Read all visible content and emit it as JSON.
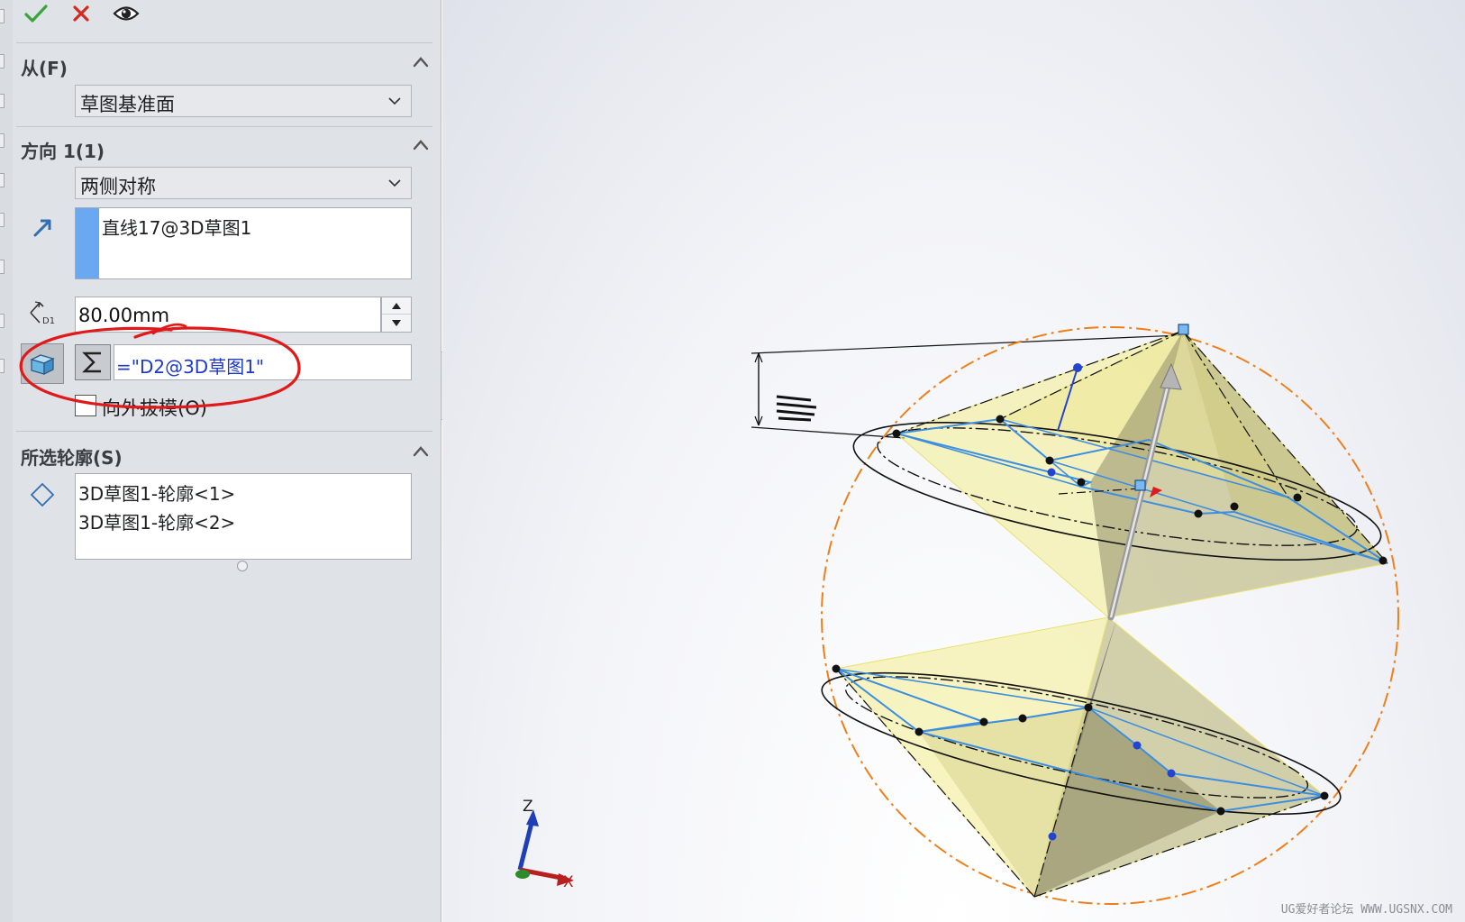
{
  "toolbar": {
    "ok_icon": "checkmark-icon",
    "cancel_icon": "x-icon",
    "preview_icon": "eye-icon"
  },
  "section_from": {
    "title": "从(F)",
    "start_condition": "草图基准面"
  },
  "section_direction1": {
    "title": "方向 1(1)",
    "end_condition": "两侧对称",
    "direction_reference": "直线17@3D草图1",
    "depth_value": "80.00mm",
    "depth_label": "D1",
    "equation_value": "=\"D2@3D草图1\"",
    "draft_outward_label": "向外拔模(O)",
    "draft_outward_checked": false
  },
  "section_contours": {
    "title": "所选轮廓(S)",
    "items": [
      "3D草图1-轮廓<1>",
      "3D草图1-轮廓<2>"
    ]
  },
  "viewport": {
    "triad": {
      "z": "Z",
      "x": "X"
    },
    "watermark": "UG爱好者论坛 WWW.UGSNX.COM"
  },
  "colors": {
    "panel_bg": "#dfe2e6",
    "accent_blue": "#6aa8f2",
    "ok_green": "#3aa33a",
    "cancel_red": "#d42a1f",
    "annotation_red": "#e01a1a",
    "sphere_orange": "#ef7f1a",
    "surface_yellow": "#f3ec8e",
    "edge_blue": "#3d8ee0"
  }
}
